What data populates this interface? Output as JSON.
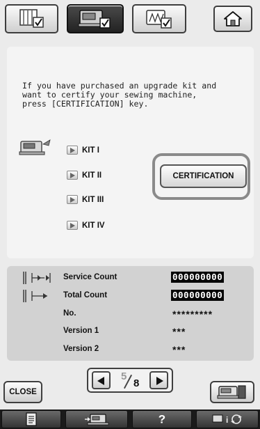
{
  "tabs": [
    {
      "icon": "settings-page-icon",
      "active": false
    },
    {
      "icon": "machine-settings-icon",
      "active": true
    },
    {
      "icon": "embroidery-settings-icon",
      "active": false
    }
  ],
  "home": {
    "icon": "home-icon"
  },
  "message": "If you have purchased an upgrade kit and\nwant to certify your sewing machine,\npress [CERTIFICATION] key.",
  "kits": [
    "KIT I",
    "KIT II",
    "KIT III",
    "KIT IV"
  ],
  "certification_label": "CERTIFICATION",
  "info": {
    "service_count_label": "Service Count",
    "service_count_value": "000000000",
    "total_count_label": "Total Count",
    "total_count_value": "000000000",
    "no_label": "No.",
    "no_value": "*********",
    "version1_label": "Version 1",
    "version1_value": "***",
    "version2_label": "Version 2",
    "version2_value": "***"
  },
  "pagination": {
    "current": "5",
    "total": "8"
  },
  "close_label": "CLOSE",
  "bottom_bar": {
    "icons": [
      "document-icon",
      "embroidery-unit-icon",
      "help-icon",
      "settings-arrows-icon"
    ],
    "help_label": "?"
  },
  "colors": {
    "background": "#ebebeb",
    "panel": "#f4f4f4",
    "info_panel": "#d2d2d2",
    "bottom_bar": "#1b1b1b"
  }
}
